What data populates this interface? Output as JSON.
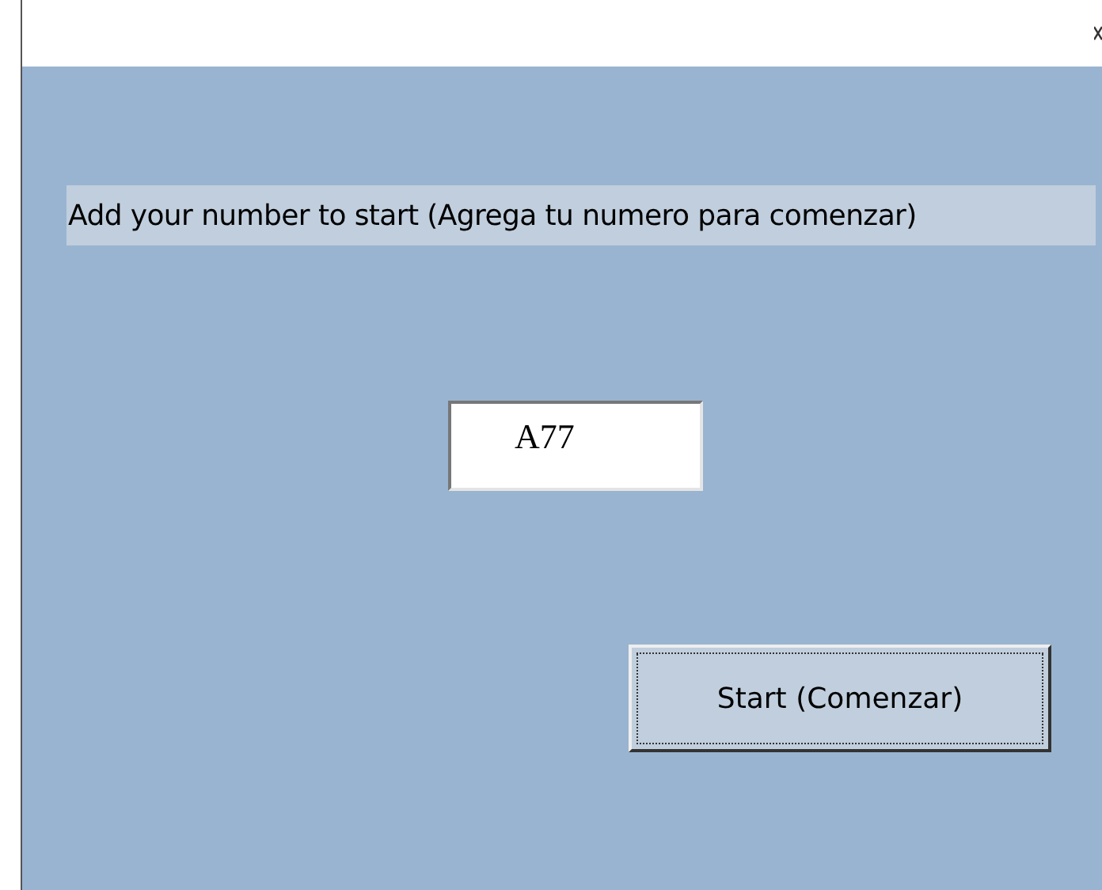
{
  "prompt": {
    "label": "Add your number to start (Agrega tu numero para comenzar)"
  },
  "number_field": {
    "value": "A77"
  },
  "buttons": [
    {
      "label": "Start (Comenzar)",
      "focused": true
    }
  ]
}
